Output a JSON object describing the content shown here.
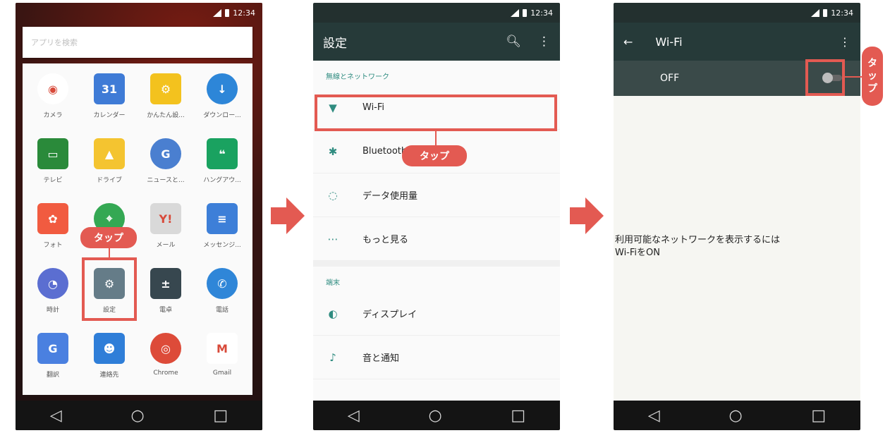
{
  "status": {
    "time": "12:34"
  },
  "phone1": {
    "search_placeholder": "アプリを検索",
    "apps": [
      {
        "label": "カメラ",
        "icon": "camera-icon",
        "color": "#ffffff",
        "glyph": "◉"
      },
      {
        "label": "カレンダー",
        "icon": "calendar-icon",
        "color": "#3f7bd6",
        "glyph": "31"
      },
      {
        "label": "かんたん設...",
        "icon": "easy-settings-icon",
        "color": "#f3c21e",
        "glyph": "⚙"
      },
      {
        "label": "ダウンロー...",
        "icon": "download-icon",
        "color": "#2d86d8",
        "glyph": "↓"
      },
      {
        "label": "テレビ",
        "icon": "tv-icon",
        "color": "#2a8a3a",
        "glyph": "▭"
      },
      {
        "label": "ドライブ",
        "icon": "drive-icon",
        "color": "#f4c430",
        "glyph": "▲"
      },
      {
        "label": "ニュースと...",
        "icon": "news-icon",
        "color": "#4a7fd0",
        "glyph": "G"
      },
      {
        "label": "ハングアウ...",
        "icon": "hangouts-icon",
        "color": "#1aa260",
        "glyph": "❝"
      },
      {
        "label": "フォト",
        "icon": "photos-icon",
        "color": "#f15b40",
        "glyph": "✿"
      },
      {
        "label": "マップ",
        "icon": "maps-icon",
        "color": "#34a853",
        "glyph": "⌖"
      },
      {
        "label": "メール",
        "icon": "yahoo-mail-icon",
        "color": "#d9d9d9",
        "glyph": "Y!"
      },
      {
        "label": "メッセンジ...",
        "icon": "messenger-icon",
        "color": "#3d7fd8",
        "glyph": "≡"
      },
      {
        "label": "時計",
        "icon": "clock-icon",
        "color": "#5b6ed1",
        "glyph": "◔"
      },
      {
        "label": "設定",
        "icon": "settings-gear-icon",
        "color": "#657c88",
        "glyph": "⚙"
      },
      {
        "label": "電卓",
        "icon": "calculator-icon",
        "color": "#37474f",
        "glyph": "±"
      },
      {
        "label": "電話",
        "icon": "phone-icon",
        "color": "#2f86d8",
        "glyph": "✆"
      },
      {
        "label": "翻訳",
        "icon": "translate-icon",
        "color": "#4a80e0",
        "glyph": "G"
      },
      {
        "label": "連絡先",
        "icon": "contacts-icon",
        "color": "#2f7ed8",
        "glyph": "☻"
      },
      {
        "label": "Chrome",
        "icon": "chrome-icon",
        "color": "#dd4b39",
        "glyph": "◎"
      },
      {
        "label": "Gmail",
        "icon": "gmail-icon",
        "color": "#ffffff",
        "glyph": "M"
      }
    ],
    "callout": "タップ"
  },
  "phone2": {
    "title": "設定",
    "section_wireless": "無線とネットワーク",
    "rows_wireless": [
      {
        "label": "Wi-Fi",
        "icon": "wifi-icon",
        "glyph": "▼"
      },
      {
        "label": "Bluetooth",
        "icon": "bluetooth-icon",
        "glyph": "✱"
      },
      {
        "label": "データ使用量",
        "icon": "data-usage-icon",
        "glyph": "◌"
      },
      {
        "label": "もっと見る",
        "icon": "more-icon",
        "glyph": "⋯"
      }
    ],
    "section_device": "端末",
    "rows_device": [
      {
        "label": "ディスプレイ",
        "icon": "display-icon",
        "glyph": "◐"
      },
      {
        "label": "音と通知",
        "icon": "bell-icon",
        "glyph": "♪"
      }
    ],
    "callout": "タップ"
  },
  "phone3": {
    "title": "Wi-Fi",
    "switch_label": "OFF",
    "message_line1": "利用可能なネットワークを表示するには",
    "message_line2": "Wi-FiをON",
    "callout_chars": [
      "タ",
      "ッ",
      "プ"
    ]
  },
  "colors": {
    "accent": "#e35a52",
    "teal": "#2f8c80",
    "appbar": "#263a39"
  }
}
